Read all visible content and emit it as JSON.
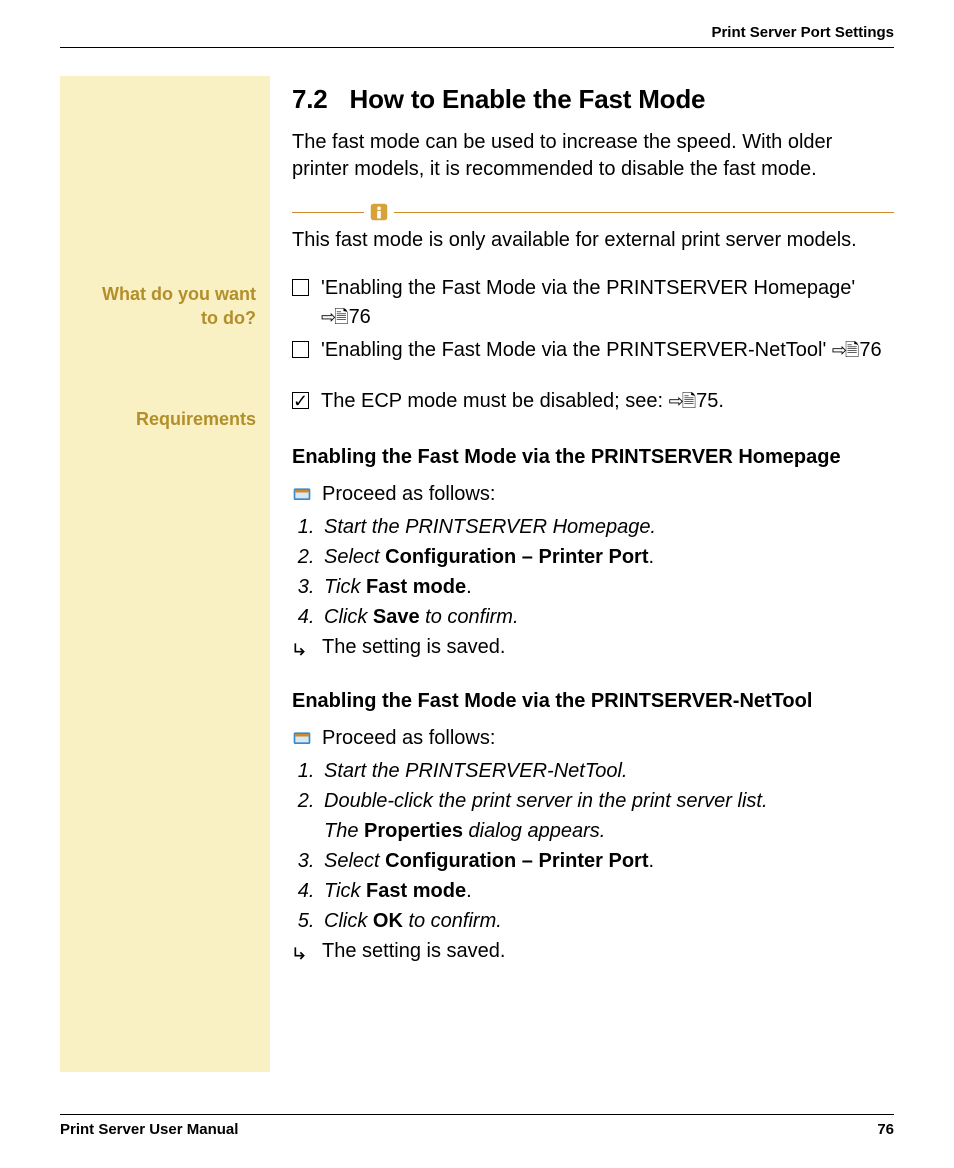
{
  "header": {
    "title": "Print Server Port Settings"
  },
  "sidebar": {
    "label_what_1": "What do you want",
    "label_what_2": "to do?",
    "label_req": "Requirements"
  },
  "section": {
    "number": "7.2",
    "title": "How to Enable the Fast Mode",
    "intro": "The fast mode can be used to increase the speed. With older printer models, it is recommended to disable the fast mode.",
    "note": "This fast mode is only available for external print server models."
  },
  "todo": {
    "item1_text": "'Enabling the Fast Mode via the PRINTSERVER Homepage'",
    "item1_ref": "76",
    "item2_text": "'Enabling the Fast Mode via the PRINTSERVER-NetTool'",
    "item2_ref": "76"
  },
  "requirements": {
    "item1_text": "The ECP mode must be disabled; see:",
    "item1_ref": "75"
  },
  "proc1": {
    "heading": "Enabling the Fast Mode via the PRINTSERVER Homepage",
    "lead": "Proceed as follows:",
    "s1": "Start the PRINTSERVER Homepage.",
    "s2_pre": "Select ",
    "s2_b": "Configuration – Printer Port",
    "s2_post": ".",
    "s3_pre": "Tick ",
    "s3_b": "Fast mode",
    "s3_post": ".",
    "s4_pre": "Click ",
    "s4_b": "Save",
    "s4_post": " to confirm.",
    "result": "The setting is saved."
  },
  "proc2": {
    "heading": "Enabling the Fast Mode via the PRINTSERVER-NetTool",
    "lead": "Proceed as follows:",
    "s1": "Start the PRINTSERVER-NetTool.",
    "s2_a": "Double-click the print server in the print server list.",
    "s2_b_pre": "The ",
    "s2_b_b": "Properties",
    "s2_b_post": " dialog appears.",
    "s3_pre": "Select ",
    "s3_b": "Configuration – Printer Port",
    "s3_post": ".",
    "s4_pre": "Tick ",
    "s4_b": "Fast mode",
    "s4_post": ".",
    "s5_pre": "Click ",
    "s5_b": "OK",
    "s5_post": " to confirm.",
    "result": "The setting is saved."
  },
  "footer": {
    "left": "Print Server User Manual",
    "right": "76"
  },
  "icons": {
    "ref_glyph": "⇨🗎"
  }
}
